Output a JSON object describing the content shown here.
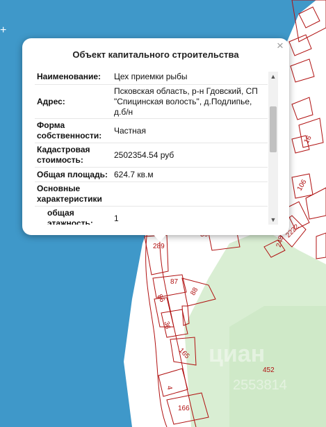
{
  "popup": {
    "title": "Объект капитального строительства",
    "close_icon": "×",
    "rows": [
      {
        "label": "Наименование:",
        "value": "Цех приемки рыбы"
      },
      {
        "label": "Адрес:",
        "value": "Псковская область, р-н Гдовский, СП \"Спицинская волость\", д.Подлипье, д.б/н"
      },
      {
        "label": "Форма собственности:",
        "value": "Частная"
      },
      {
        "label": "Кадастровая стоимость:",
        "value": "2502354.54 руб"
      },
      {
        "label": "Общая площадь:",
        "value": "624.7 кв.м"
      },
      {
        "label": "Основные характеристики",
        "value": ""
      },
      {
        "label": "общая этажность:",
        "value": "1"
      }
    ],
    "scroll_up_icon": "▲",
    "scroll_down_icon": "▼"
  },
  "map": {
    "water_color": "#3f98c9",
    "land_color": "#ffffff",
    "park_color": "#d9eed3",
    "parcel_color": "#b01010",
    "labels": [
      "289",
      "87",
      "86",
      "88",
      "36",
      "165",
      "452",
      "166",
      "4",
      "106",
      "248",
      "2222",
      "16",
      "36"
    ],
    "watermark": "циан",
    "watermark_id": "2553814"
  }
}
